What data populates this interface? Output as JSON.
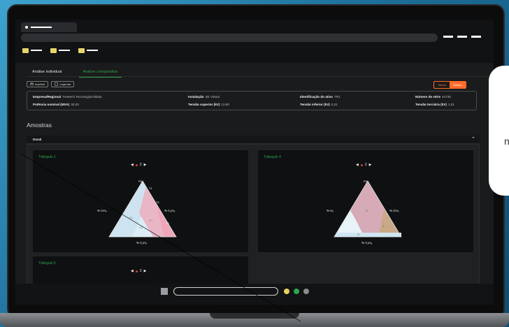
{
  "app": {
    "tabs": [
      "Análise individual",
      "Análise comparativa"
    ],
    "toolbar": {
      "print": "Imprimir",
      "legend": "Legenda"
    },
    "toggle": [
      "Tabela",
      "Gráfico"
    ]
  },
  "info": {
    "row1": [
      {
        "k": "Empresa/Regional",
        "v": "Treetech Tecnologia/Atibaia"
      },
      {
        "k": "Instalação",
        "v": "SE Virtual"
      },
      {
        "k": "Identificação do ativo",
        "v": "TR1"
      },
      {
        "k": "Número de série",
        "v": "44735"
      }
    ],
    "row2": [
      {
        "k": "Potência nominal (MVA)",
        "v": "30,00"
      },
      {
        "k": "Tensão superior (kV)",
        "v": "13,80"
      },
      {
        "k": "Tensão inferior (kV)",
        "v": "0,22"
      },
      {
        "k": "Tensão terciária (kV)",
        "v": "1,01"
      }
    ]
  },
  "samples": {
    "title": "Amostras",
    "panel": "Duval"
  },
  "cards": [
    {
      "title": "Triângulo 1",
      "page": "2",
      "labels": {
        "left": "% CH₄",
        "right": "% C₂H₄",
        "bottom": "% C₂H₂",
        "top": "PD",
        "t1": "T1",
        "t2": "T2",
        "t3": "T3",
        "d1": "D1",
        "d2": "D2",
        "dt": "DT"
      }
    },
    {
      "title": "Triângulo 4",
      "page": "2",
      "labels": {
        "left": "% H₂",
        "right": "% CH₄",
        "bottom": "% C₂H₆",
        "top": "PD",
        "s": "S",
        "c": "C",
        "o": "O"
      }
    },
    {
      "title": "Triângulo 5",
      "page": "2"
    }
  ],
  "side_bubble": "n",
  "colors": {
    "accent_green": "#2ea44f",
    "accent_orange": "#ff6b2b",
    "marker_red": "#e53935"
  }
}
